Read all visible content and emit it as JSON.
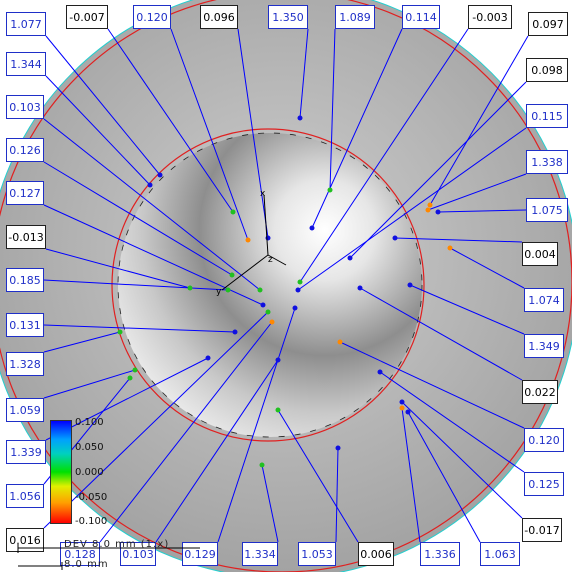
{
  "colors": {
    "label_blue": "#1f2fc8",
    "measure_line": "#0000ff",
    "cad_circle": "#e02020",
    "sphere_grey": "#b4b4b4"
  },
  "labels": [
    {
      "text": "1.077",
      "color": "blue"
    },
    {
      "text": "-0.007",
      "color": "black"
    },
    {
      "text": "0.120",
      "color": "blue"
    },
    {
      "text": "0.096",
      "color": "black"
    },
    {
      "text": "1.350",
      "color": "blue"
    },
    {
      "text": "1.089",
      "color": "blue"
    },
    {
      "text": "0.114",
      "color": "blue"
    },
    {
      "text": "-0.003",
      "color": "black"
    },
    {
      "text": "0.097",
      "color": "black"
    },
    {
      "text": "1.344",
      "color": "blue"
    },
    {
      "text": "0.098",
      "color": "black"
    },
    {
      "text": "0.103",
      "color": "blue"
    },
    {
      "text": "0.115",
      "color": "blue"
    },
    {
      "text": "0.126",
      "color": "blue"
    },
    {
      "text": "1.338",
      "color": "blue"
    },
    {
      "text": "0.127",
      "color": "blue"
    },
    {
      "text": "1.075",
      "color": "blue"
    },
    {
      "text": "-0.013",
      "color": "black"
    },
    {
      "text": "0.004",
      "color": "black"
    },
    {
      "text": "0.185",
      "color": "blue"
    },
    {
      "text": "1.074",
      "color": "blue"
    },
    {
      "text": "0.131",
      "color": "blue"
    },
    {
      "text": "1.349",
      "color": "blue"
    },
    {
      "text": "1.328",
      "color": "blue"
    },
    {
      "text": "0.022",
      "color": "black"
    },
    {
      "text": "1.059",
      "color": "blue"
    },
    {
      "text": "0.120",
      "color": "blue"
    },
    {
      "text": "1.339",
      "color": "blue"
    },
    {
      "text": "0.125",
      "color": "blue"
    },
    {
      "text": "1.056",
      "color": "blue"
    },
    {
      "text": "-0.017",
      "color": "black"
    },
    {
      "text": "0.016",
      "color": "black"
    },
    {
      "text": "0.128",
      "color": "blue"
    },
    {
      "text": "0.103",
      "color": "blue"
    },
    {
      "text": "0.129",
      "color": "blue"
    },
    {
      "text": "1.334",
      "color": "blue"
    },
    {
      "text": "1.053",
      "color": "blue"
    },
    {
      "text": "0.006",
      "color": "black"
    },
    {
      "text": "1.336",
      "color": "blue"
    },
    {
      "text": "1.063",
      "color": "blue"
    }
  ],
  "legend": {
    "ticks": [
      "0.100",
      "0.050",
      "0.000",
      "-0.050",
      "-0.100"
    ]
  },
  "scale_bar": {
    "text": "DEV 8.0 mm (1:x)",
    "sub": "8.0 mm"
  },
  "axes": {
    "x": "x",
    "y": "y",
    "z": "z"
  }
}
